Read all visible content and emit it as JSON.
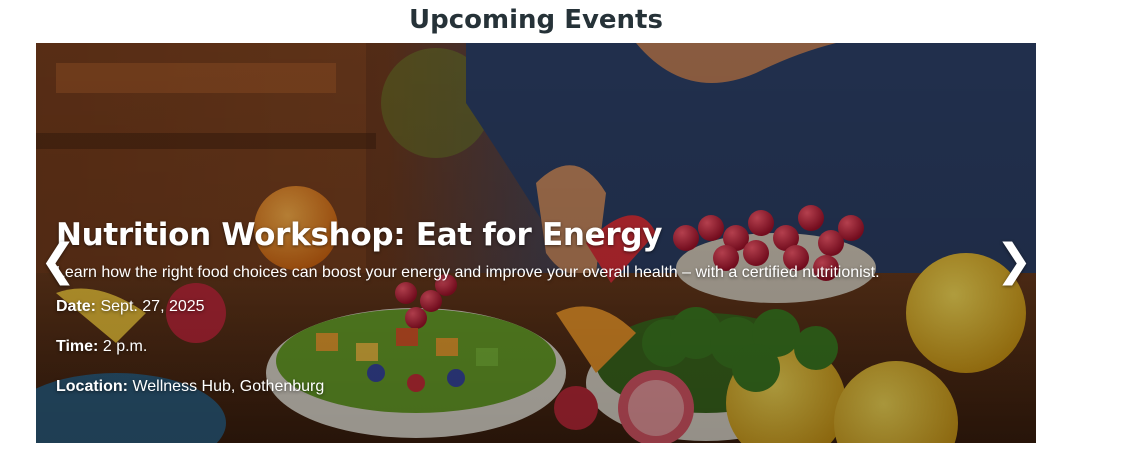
{
  "section": {
    "title": "Upcoming Events"
  },
  "carousel": {
    "prev_icon": "❮",
    "next_icon": "❯",
    "slide": {
      "image_icon": "healthy-food-photo",
      "title": "Nutrition Workshop: Eat for Energy",
      "description": "Learn how the right food choices can boost your energy and improve your overall health – with a certified nutritionist.",
      "date_label": "Date:",
      "date_value": "Sept. 27, 2025",
      "time_label": "Time:",
      "time_value": "2 p.m.",
      "location_label": "Location:",
      "location_value": "Wellness Hub, Gothenburg"
    }
  },
  "colors": {
    "title_text": "#263238",
    "overlay_text": "#ffffff"
  }
}
